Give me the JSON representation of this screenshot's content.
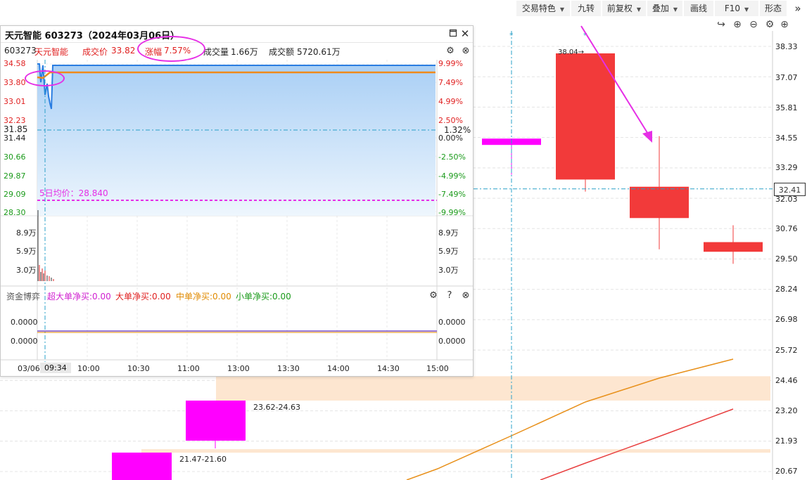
{
  "toolbar": {
    "items": [
      {
        "label": "交易特色",
        "dropdown": true
      },
      {
        "label": "九转",
        "dropdown": false
      },
      {
        "label": "前复权",
        "dropdown": true
      },
      {
        "label": "叠加",
        "dropdown": true
      },
      {
        "label": "画线",
        "dropdown": false
      },
      {
        "label": "F10",
        "dropdown": true
      },
      {
        "label": "形态",
        "dropdown": false
      }
    ],
    "expand_icon": "double-chevron-right-icon"
  },
  "main_chart": {
    "controls": [
      "redo-icon",
      "zoom-in-icon",
      "zoom-out-icon",
      "settings-icon",
      "zoom-in-icon"
    ],
    "price_axis": [
      "38.33",
      "37.07",
      "35.81",
      "34.55",
      "33.29",
      "32.03",
      "30.76",
      "29.50",
      "28.24",
      "26.98",
      "25.72",
      "24.46",
      "23.20",
      "21.93",
      "20.67"
    ],
    "current_price": "32.41",
    "candles": [
      {
        "open": 34.5,
        "close": 34.5,
        "high": 34.5,
        "low": 33.0,
        "color": "#ff00ff"
      },
      {
        "open": 32.8,
        "close": 38.04,
        "high": 38.04,
        "low": 32.3,
        "color": "#f23a3a"
      },
      {
        "open": 32.5,
        "close": 31.2,
        "high": 34.6,
        "low": 29.9,
        "color": "#f23a3a"
      },
      {
        "open": 30.2,
        "close": 29.8,
        "high": 30.9,
        "low": 29.3,
        "color": "#f23a3a"
      }
    ],
    "high_mark": "38.04→",
    "zones": [
      {
        "label": "23.62-24.63",
        "low": 23.62,
        "high": 24.63,
        "color": "#fde6d0"
      },
      {
        "label": "21.47-21.60",
        "low": 21.47,
        "high": 21.6,
        "color": "#fde6d0"
      }
    ],
    "accent": "#e62ee6"
  },
  "popup": {
    "title": "天元智能 603273（2024年03月06日）",
    "info": {
      "code": "603273",
      "name": "天元智能",
      "price_label": "成交价",
      "price": "33.82",
      "change_label": "涨幅",
      "change": "7.57%",
      "volume_label": "成交量",
      "volume": "1.66万",
      "amount_label": "成交额",
      "amount": "5720.61万"
    },
    "left_axis": [
      {
        "v": "34.58",
        "c": "red"
      },
      {
        "v": "33.80",
        "c": "red"
      },
      {
        "v": "33.01",
        "c": "red"
      },
      {
        "v": "32.23",
        "c": "red"
      },
      {
        "v": "31.44",
        "c": "dark"
      },
      {
        "v": "30.66",
        "c": "green"
      },
      {
        "v": "29.87",
        "c": "green"
      },
      {
        "v": "29.09",
        "c": "green"
      },
      {
        "v": "28.30",
        "c": "green"
      }
    ],
    "right_axis": [
      {
        "v": "9.99%",
        "c": "red"
      },
      {
        "v": "7.49%",
        "c": "red"
      },
      {
        "v": "4.99%",
        "c": "red"
      },
      {
        "v": "2.50%",
        "c": "red"
      },
      {
        "v": "0.00%",
        "c": "dark"
      },
      {
        "v": "-2.50%",
        "c": "green"
      },
      {
        "v": "-4.99%",
        "c": "green"
      },
      {
        "v": "-7.49%",
        "c": "green"
      },
      {
        "v": "-9.99%",
        "c": "green"
      }
    ],
    "prev_close": "31.85",
    "prev_close_pct": "1.32%",
    "avg5_label": "5日均价：28.840",
    "volume_axis": [
      "8.9万",
      "5.9万",
      "3.0万"
    ],
    "flow": {
      "label": "资金博弈",
      "items": [
        {
          "text": "超大单净买:0.00",
          "color": "#d020d0"
        },
        {
          "text": "大单净买:0.00",
          "color": "#e02020"
        },
        {
          "text": "中单净买:0.00",
          "color": "#e08a00"
        },
        {
          "text": "小单净买:0.00",
          "color": "#1a9a1a"
        }
      ],
      "axis": [
        "0.0000",
        "0.0000"
      ]
    },
    "time_axis": [
      "03/06",
      "09:34",
      "10:00",
      "10:30",
      "11:00",
      "13:00",
      "13:30",
      "14:00",
      "14:30",
      "15:00"
    ]
  }
}
